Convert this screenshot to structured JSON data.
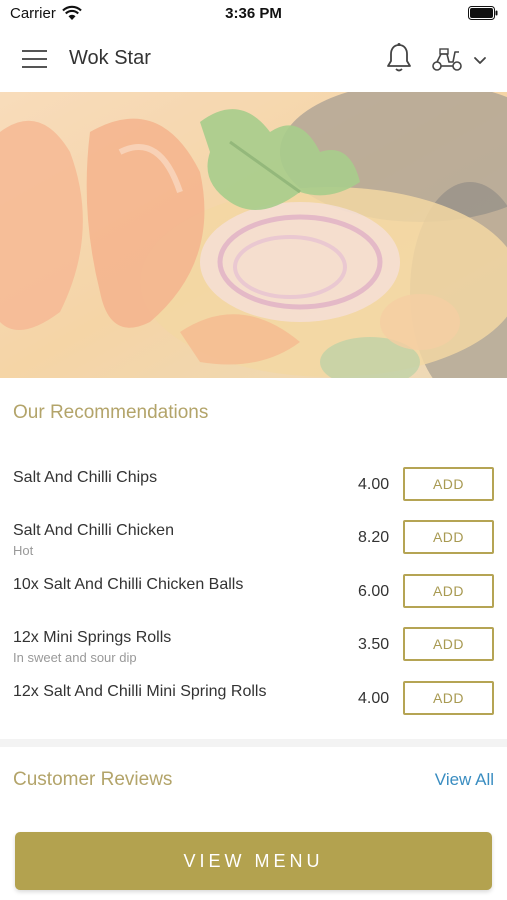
{
  "status_bar": {
    "carrier": "Carrier",
    "time": "3:36 PM"
  },
  "header": {
    "title": "Wok Star",
    "icons": {
      "menu": "hamburger-menu-icon",
      "bell": "bell-icon",
      "delivery": "scooter-icon",
      "dropdown": "chevron-down-icon"
    }
  },
  "hero": {
    "image": "thai-soup-prawns-photo"
  },
  "recommendations": {
    "title": "Our Recommendations",
    "add_label": "ADD",
    "items": [
      {
        "name": "Salt And Chilli Chips",
        "description": "",
        "price": "4.00"
      },
      {
        "name": "Salt And Chilli Chicken",
        "description": "Hot",
        "price": "8.20"
      },
      {
        "name": "10x Salt And Chilli Chicken Balls",
        "description": "",
        "price": "6.00"
      },
      {
        "name": "12x Mini Springs Rolls",
        "description": "In sweet and sour dip",
        "price": "3.50"
      },
      {
        "name": "12x Salt And Chilli Mini Spring Rolls",
        "description": "",
        "price": "4.00"
      }
    ]
  },
  "reviews": {
    "title": "Customer Reviews",
    "view_all": "View All"
  },
  "footer": {
    "view_menu_label": "VIEW MENU"
  },
  "colors": {
    "accent": "#b3a24f",
    "link": "#3a8dc1"
  }
}
